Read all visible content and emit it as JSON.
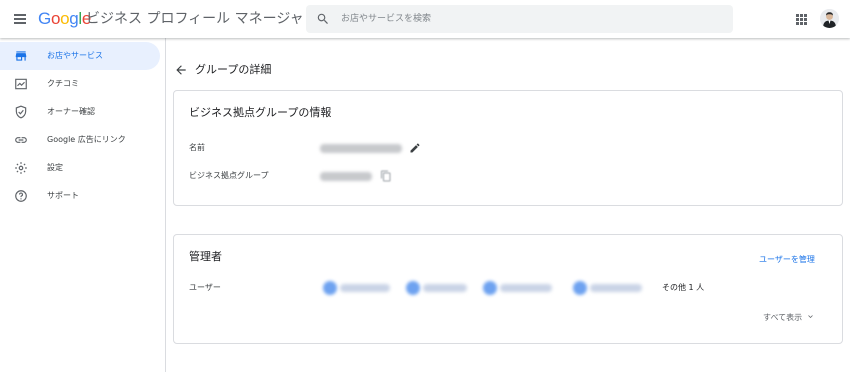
{
  "header": {
    "logo_letters": [
      {
        "ch": "G",
        "color": "#4285F4"
      },
      {
        "ch": "o",
        "color": "#EA4335"
      },
      {
        "ch": "o",
        "color": "#FBBC05"
      },
      {
        "ch": "g",
        "color": "#4285F4"
      },
      {
        "ch": "l",
        "color": "#34A853"
      },
      {
        "ch": "e",
        "color": "#EA4335"
      }
    ],
    "product_name": "ビジネス プロフィール マネージャ",
    "search_placeholder": "お店やサービスを検索",
    "menu_icon": "hamburger-menu-icon",
    "apps_icon": "apps-grid-icon"
  },
  "sidebar": {
    "items": [
      {
        "label": "お店やサービス",
        "icon": "storefront-icon",
        "active": true
      },
      {
        "label": "クチコミ",
        "icon": "reviews-icon",
        "active": false
      },
      {
        "label": "オーナー確認",
        "icon": "verified-shield-icon",
        "active": false
      },
      {
        "label": "Google 広告にリンク",
        "icon": "link-icon",
        "active": false
      },
      {
        "label": "設定",
        "icon": "gear-icon",
        "active": false
      },
      {
        "label": "サポート",
        "icon": "help-icon",
        "active": false
      }
    ]
  },
  "main": {
    "page_title": "グループの詳細",
    "info_card": {
      "title": "ビジネス拠点グループの情報",
      "name_label": "名前",
      "group_label": "ビジネス拠点グループ"
    },
    "admin_card": {
      "title": "管理者",
      "manage_link": "ユーザーを管理",
      "users_label": "ユーザー",
      "more_text": "その他 1 人",
      "show_all": "すべて表示"
    }
  },
  "colors": {
    "accent": "#1a73e8",
    "active_bg": "#e8f0fe",
    "border": "#dadce0"
  }
}
